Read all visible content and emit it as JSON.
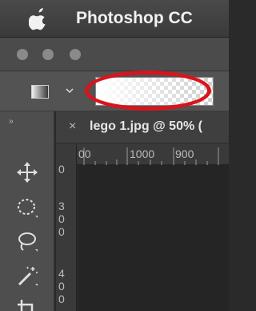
{
  "menubar": {
    "app_name": "Photoshop CC",
    "apple_icon": "apple-icon"
  },
  "window": {
    "traffic_lights": [
      "close",
      "minimize",
      "zoom"
    ]
  },
  "options_bar": {
    "tool_icon": "gradient-tool-icon",
    "preset_dropdown_icon": "chevron-down-icon",
    "gradient_picker": {
      "from": "#ffffff",
      "to": "transparent"
    },
    "highlight_color": "#d8141c"
  },
  "document_tab": {
    "close_symbol": "×",
    "title": "lego 1.jpg @ 50% ("
  },
  "tools_panel": {
    "collapse_symbol": "››",
    "tools": [
      "move-tool-icon",
      "elliptical-marquee-tool-icon",
      "lasso-tool-icon",
      "magic-wand-tool-icon",
      "crop-tool-icon"
    ]
  },
  "ruler_top": {
    "labels": [
      "00",
      "1000",
      "900"
    ]
  },
  "ruler_left": {
    "groups": [
      [
        "0"
      ],
      [
        "3",
        "0",
        "0"
      ],
      [
        "4",
        "0",
        "0"
      ]
    ]
  },
  "colors": {
    "canvas": "#252525",
    "chrome": "#535353"
  }
}
